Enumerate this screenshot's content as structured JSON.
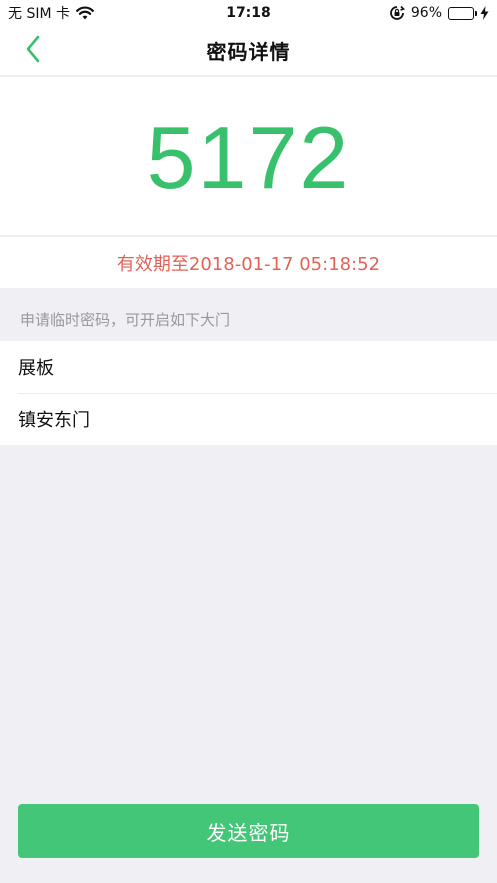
{
  "status_bar": {
    "carrier": "无 SIM 卡",
    "time": "17:18",
    "battery_percent": "96%",
    "battery_level": 0.96,
    "icons": [
      "wifi-icon",
      "lock-rotation-icon",
      "battery-icon",
      "charging-icon"
    ]
  },
  "nav": {
    "title": "密码详情",
    "back_icon": "chevron-left-icon"
  },
  "code": {
    "value": "5172",
    "expiry": "有效期至2018-01-17 05:18:52"
  },
  "doors": {
    "header": "申请临时密码，可开启如下大门",
    "items": [
      {
        "label": "展板"
      },
      {
        "label": "镇安东门"
      }
    ]
  },
  "actions": {
    "send_label": "发送密码"
  },
  "colors": {
    "accent": "#43c677",
    "code_text": "#39c06d",
    "expiry_text": "#e0635a",
    "background": "#efeff4"
  }
}
